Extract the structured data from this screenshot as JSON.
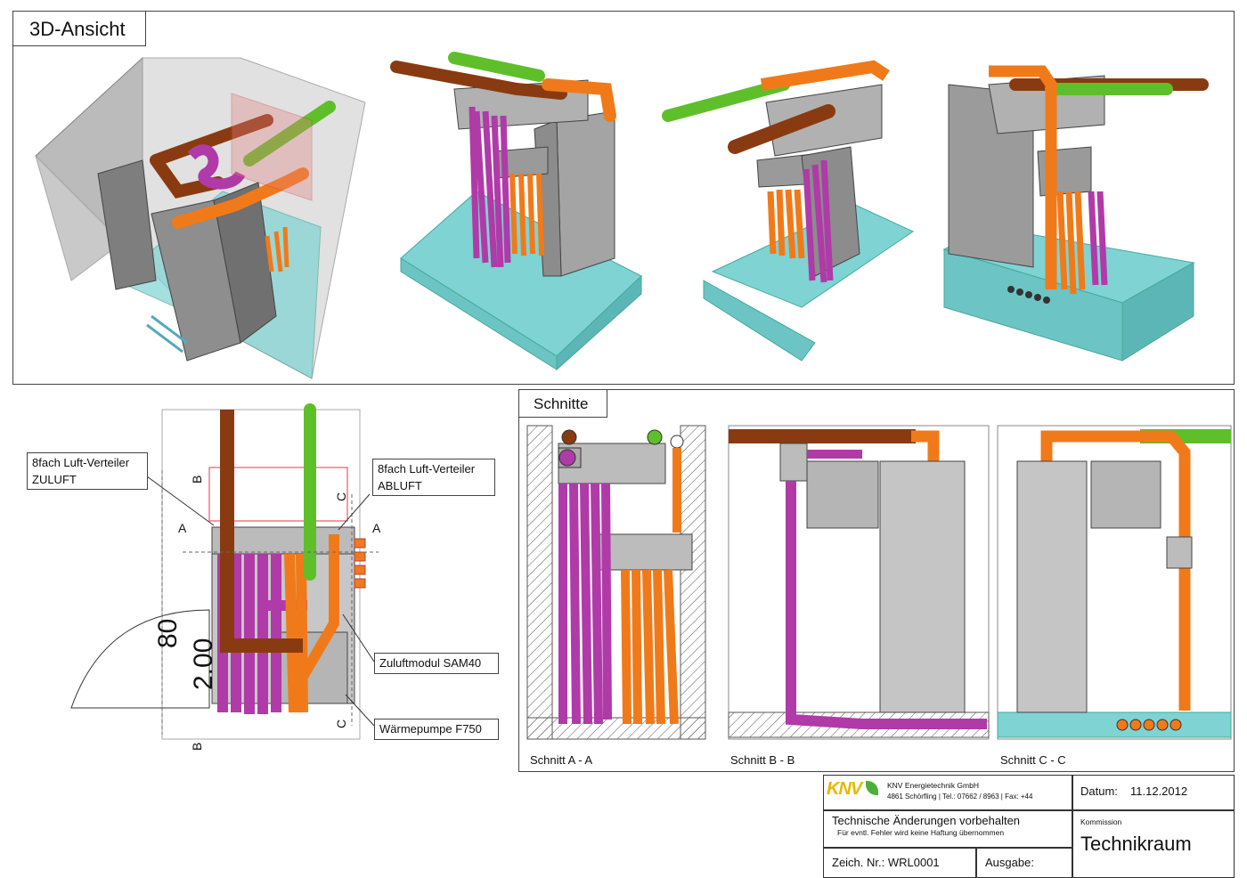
{
  "top_panel": {
    "title": "3D-Ansicht"
  },
  "plan": {
    "callout_zuluft_line1": "8fach Luft-Verteiler",
    "callout_zuluft_line2": "ZULUFT",
    "callout_abluft_line1": "8fach Luft-Verteiler",
    "callout_abluft_line2": "ABLUFT",
    "callout_module": "Zuluftmodul SAM40",
    "callout_heatpump": "Wärmepumpe F750",
    "dim_80": "80",
    "dim_200": "2.00",
    "section_a": "A",
    "section_b": "B",
    "section_c": "C"
  },
  "sections": {
    "title": "Schnitte",
    "label_a": "Schnitt A - A",
    "label_b": "Schnitt B - B",
    "label_c": "Schnitt C - C"
  },
  "title_block": {
    "logo_text": "KNV",
    "company_name": "KNV Energietechnik GmbH",
    "company_address": "4861 Schörfling | Tel.: 07662 / 8963 | Fax: +44",
    "notice_title": "Technische Änderungen vorbehalten",
    "notice_sub": "Für evntl. Fehler wird keine Haftung übernommen",
    "drawing_no": "Zeich. Nr.: WRL0001",
    "issue_label": "Ausgabe:",
    "date_label": "Datum:",
    "date_value": "11.12.2012",
    "commission_label": "Kommission",
    "commission_value": "Technikraum"
  },
  "colors": {
    "brown": "#8a3a10",
    "green": "#5fbf2a",
    "orange": "#f07a1a",
    "magenta": "#b03aa8",
    "grey": "#a9aba9",
    "teal": "#7fd3d3"
  }
}
